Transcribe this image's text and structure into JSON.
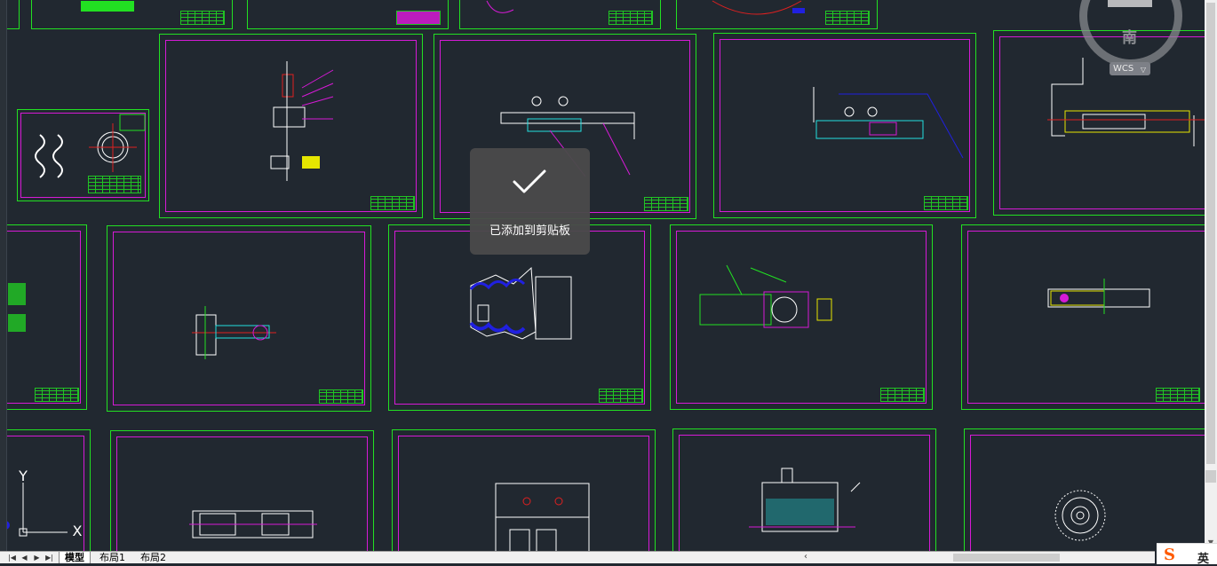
{
  "toast": {
    "message": "已添加到剪贴板",
    "icon": "checkmark-icon"
  },
  "viewcube": {
    "direction_label": "南"
  },
  "wcs": {
    "label": "WCS",
    "caret": "▽"
  },
  "ucs": {
    "y_label": "Y",
    "x_label": "X"
  },
  "layout_tabs": [
    {
      "label": "模型",
      "active": true
    },
    {
      "label": "布局1",
      "active": false
    },
    {
      "label": "布局2",
      "active": false
    }
  ],
  "tab_nav": [
    "|◀",
    "◀",
    "▶",
    "▶|"
  ],
  "ime": {
    "logo": "S",
    "lang": "英"
  },
  "colors": {
    "background": "#212830",
    "sheet_border": "#22e022",
    "sheet_inner": "#d61ad6",
    "toast_bg": "#4a4a4a"
  }
}
